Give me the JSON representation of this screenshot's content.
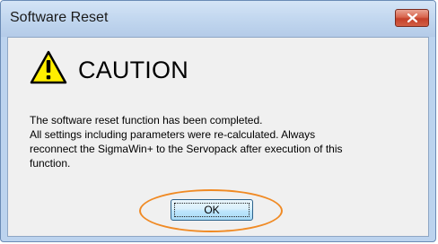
{
  "dialog": {
    "title": "Software Reset",
    "close_icon": "close-icon",
    "heading": "CAUTION",
    "warning_icon": "warning-triangle-icon",
    "message_lines": [
      "The software reset function has been completed.",
      "All settings including parameters were re-calculated. Always",
      "reconnect the SigmaWin+ to the Servopack after execution of this",
      "function."
    ],
    "ok_label": "OK"
  },
  "colors": {
    "highlight_ring": "#f08a24",
    "close_button": "#c4402a",
    "warning_yellow": "#ffee00"
  }
}
